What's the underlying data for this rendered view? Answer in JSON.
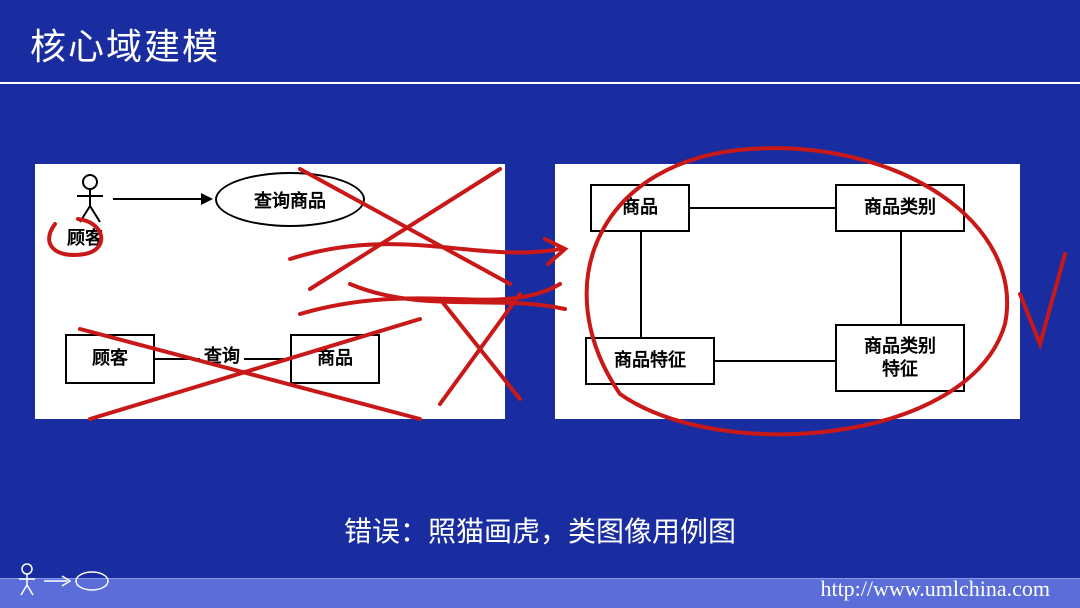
{
  "title": "核心域建模",
  "left_diagram": {
    "actor": "顾客",
    "usecase": "查询商品",
    "class1": "顾客",
    "class2": "商品",
    "assoc_label": "查询"
  },
  "right_diagram": {
    "box1": "商品",
    "box2": "商品类别",
    "box3": "商品特征",
    "box4": "商品类别\n特征"
  },
  "caption": "错误：照猫画虎，类图像用例图",
  "footer_url": "http://www.umlchina.com"
}
